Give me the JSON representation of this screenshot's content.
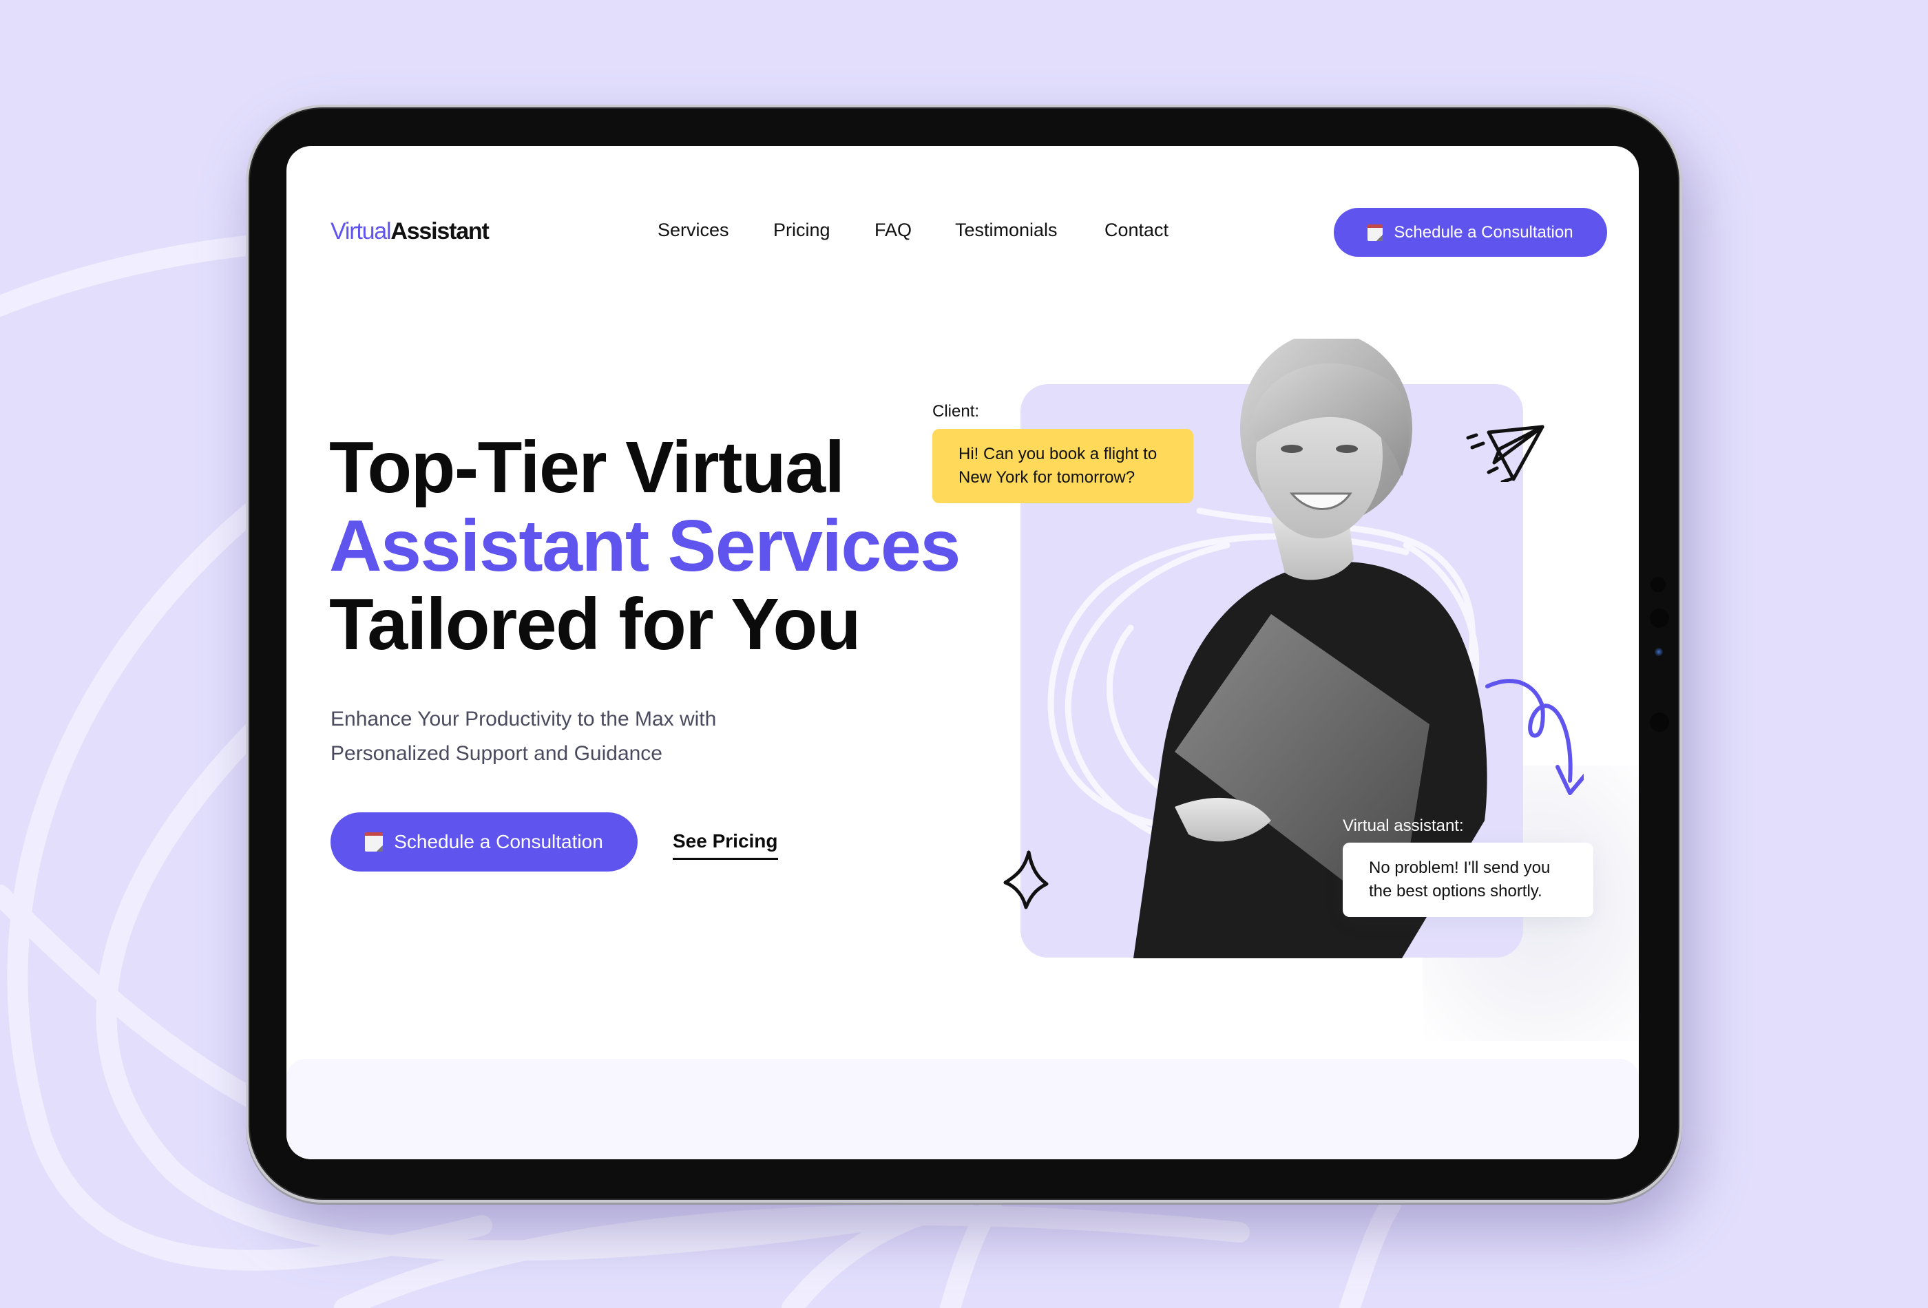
{
  "header": {
    "logo": {
      "primary": "Virtual",
      "secondary": "Assistant"
    },
    "nav": [
      {
        "label": "Services"
      },
      {
        "label": "Pricing"
      },
      {
        "label": "FAQ"
      },
      {
        "label": "Testimonials"
      },
      {
        "label": "Contact"
      }
    ],
    "cta": {
      "icon": "calendar-icon",
      "label": "Schedule a Consultation"
    }
  },
  "hero": {
    "headline": {
      "line1": "Top-Tier Virtual",
      "line2": "Assistant Services",
      "line3": "Tailored for You"
    },
    "subtitle": {
      "line1": "Enhance Your Productivity to the Max with",
      "line2": "Personalized Support and Guidance"
    },
    "primary_cta": {
      "icon": "calendar-icon",
      "label": "Schedule a Consultation"
    },
    "secondary_cta": {
      "label": "See Pricing"
    }
  },
  "chat": {
    "client": {
      "label": "Client:",
      "message_line1": "Hi! Can you book a flight to",
      "message_line2": "New York for tomorrow?"
    },
    "assistant": {
      "label": "Virtual assistant:",
      "message_line1": "No problem! I'll send you",
      "message_line2": "the best options shortly."
    }
  },
  "colors": {
    "accent": "#5f55ee",
    "page_background": "#e2defc",
    "client_bubble": "#fed95a",
    "card_background": "#e2defc",
    "text_dark": "#0b0b0b",
    "text_muted": "#4a4a5e"
  },
  "decorations": [
    "paper-plane-icon",
    "sparkle-icon",
    "curly-arrow-icon",
    "scribble-lines"
  ]
}
